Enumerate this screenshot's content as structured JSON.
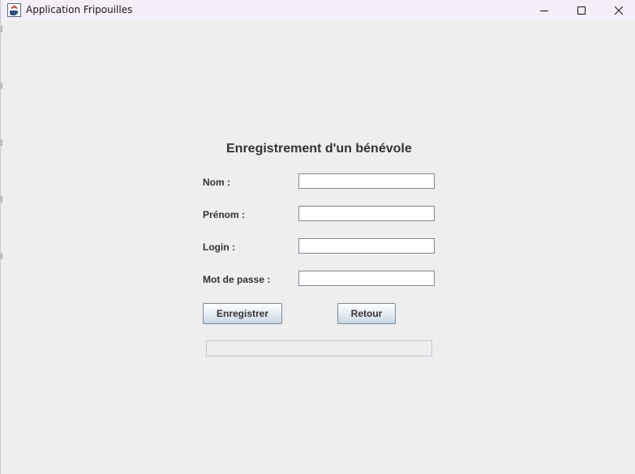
{
  "window": {
    "title": "Application Fripouilles",
    "app_icon": "java-cup-icon",
    "controls": [
      "minimize-icon",
      "maximize-icon",
      "close-icon"
    ]
  },
  "form": {
    "heading": "Enregistrement d'un bénévole",
    "fields": [
      {
        "label": "Nom :",
        "value": ""
      },
      {
        "label": "Prénom :",
        "value": ""
      },
      {
        "label": "Login :",
        "value": ""
      },
      {
        "label": "Mot de passe :",
        "value": ""
      }
    ],
    "buttons": {
      "register": "Enregistrer",
      "back": "Retour"
    },
    "progress": {
      "value": 0
    }
  },
  "colors": {
    "background": "#eeeeee",
    "titlebar": "#f3eef7",
    "text": "#333333",
    "field_border": "#7a8a99",
    "button_gradient_bottom": "#c8d7e6"
  }
}
